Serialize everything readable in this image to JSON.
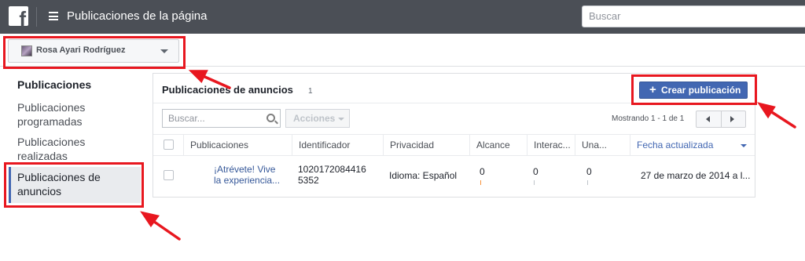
{
  "topbar": {
    "logo_letter": "f",
    "title": "Publicaciones de la página",
    "search_placeholder": "Buscar"
  },
  "page_selector": {
    "name": "Rosa Ayari Rodríguez"
  },
  "sidebar": {
    "items": [
      {
        "label": "Publicaciones"
      },
      {
        "label": "Publicaciones programadas"
      },
      {
        "label": "Publicaciones realizadas"
      },
      {
        "label": "Publicaciones de anuncios"
      }
    ]
  },
  "panel": {
    "title": "Publicaciones de anuncios",
    "count": "1",
    "create_button": "Crear publicación",
    "search_placeholder": "Buscar...",
    "actions_label": "Acciones",
    "showing": "Mostrando 1 - 1 de 1",
    "columns": [
      "Publicaciones",
      "Identificador",
      "Privacidad",
      "Alcance",
      "Interac...",
      "Una...",
      "Fecha actualizada"
    ],
    "rows": [
      {
        "post": "¡Atrévete! Vive la experiencia...",
        "id": "10201720844165352",
        "privacy": "Idioma: Español",
        "reach": "0",
        "interactions": "0",
        "una": "0",
        "date": "27 de marzo de 2014 a l..."
      }
    ]
  },
  "colors": {
    "topbar": "#4b4f56",
    "accent": "#4267b2",
    "annotation": "#e8171f"
  }
}
